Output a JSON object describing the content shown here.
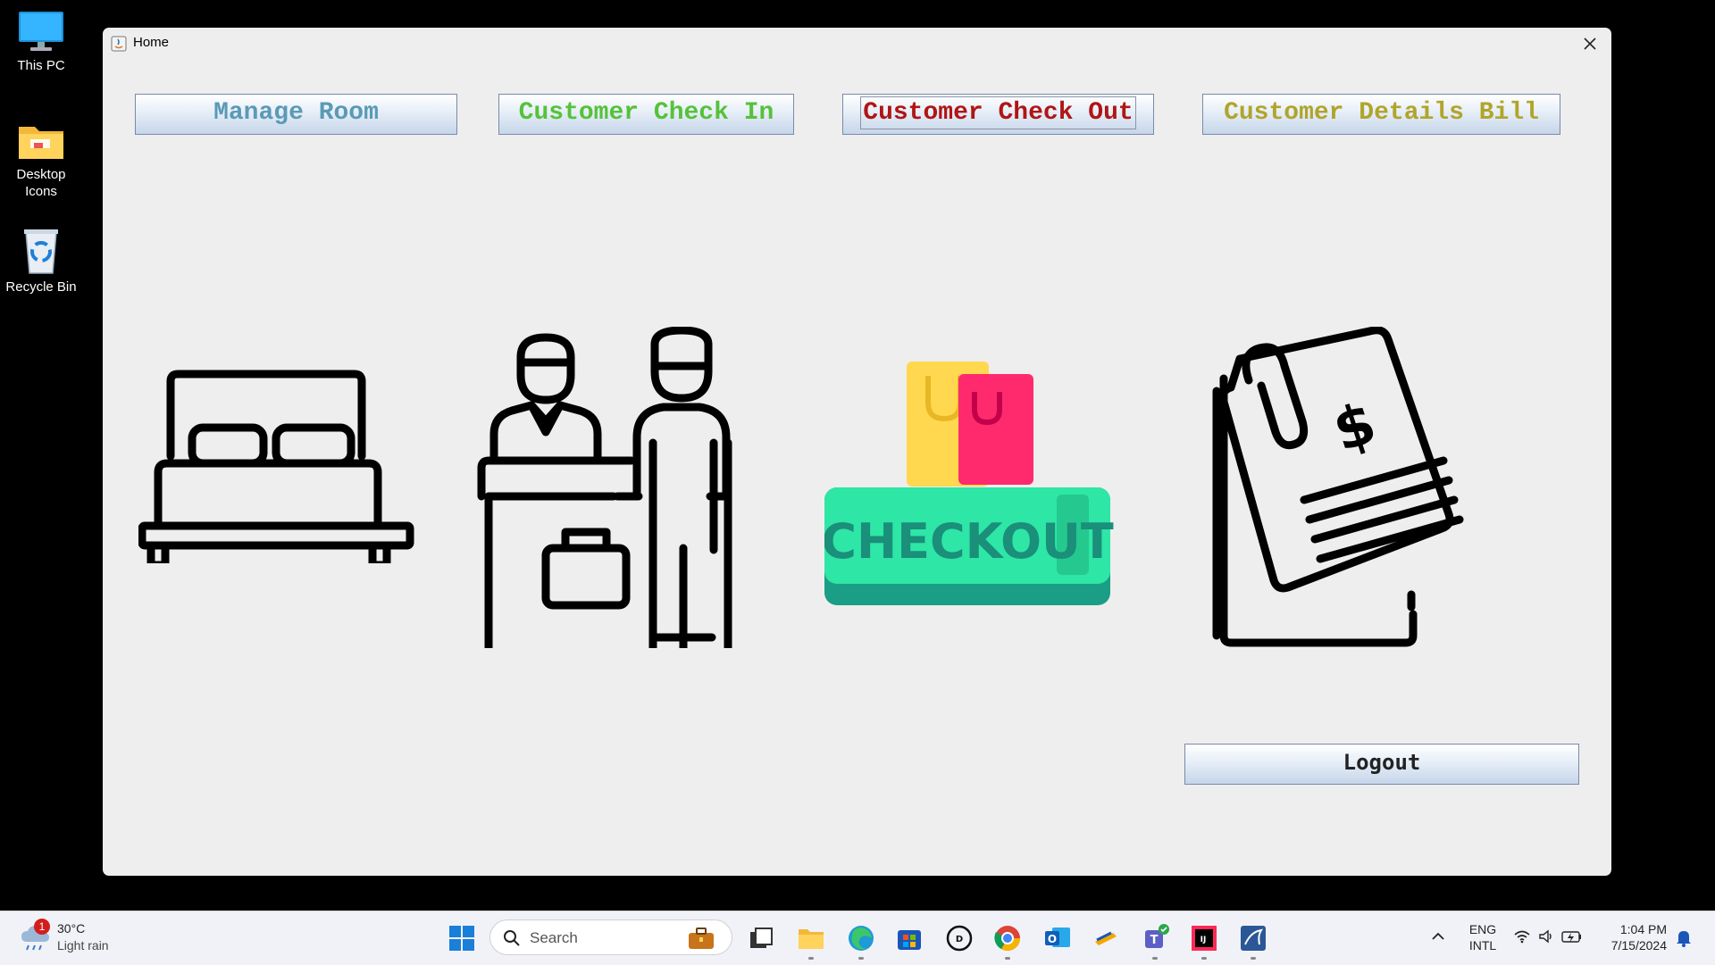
{
  "desktop": {
    "icons": [
      {
        "label": "This PC"
      },
      {
        "label": "Desktop Icons"
      },
      {
        "label": "Recycle Bin"
      }
    ]
  },
  "window": {
    "title": "Home",
    "buttons": {
      "manage_room": {
        "label": "Manage Room",
        "color": "#5a9ab7"
      },
      "check_in": {
        "label": "Customer Check In",
        "color": "#55c23a"
      },
      "check_out": {
        "label": "Customer Check Out",
        "color": "#b01515"
      },
      "details_bill": {
        "label": "Customer Details Bill",
        "color": "#b0a52a"
      },
      "logout": {
        "label": "Logout",
        "color": "#222222"
      }
    },
    "illustrations": {
      "checkout_sign_text": "CHECKOUT"
    }
  },
  "taskbar": {
    "weather": {
      "temp": "30°C",
      "condition": "Light rain",
      "badge": "1"
    },
    "search_placeholder": "Search",
    "language": {
      "line1": "ENG",
      "line2": "INTL"
    },
    "clock": {
      "time": "1:04 PM",
      "date": "7/15/2024"
    },
    "apps": [
      "start-icon",
      "search",
      "briefcase-icon",
      "task-view-icon",
      "file-explorer-icon",
      "edge-icon",
      "store-icon",
      "dell-icon",
      "chrome-icon",
      "outlook-icon",
      "pen-app-icon",
      "teams-icon",
      "intellij-icon",
      "mysql-workbench-icon"
    ]
  },
  "colors": {
    "window_bg": "#eeeeee",
    "desktop_bg": "#000000",
    "checkout_green": "#2ee6a6",
    "checkout_dark": "#1a9e85"
  }
}
